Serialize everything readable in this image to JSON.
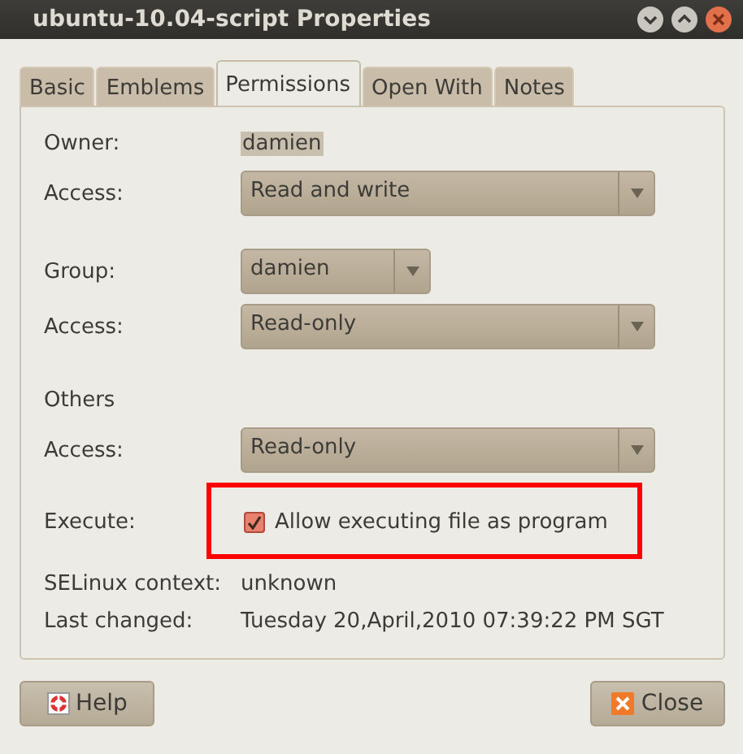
{
  "window": {
    "title": "ubuntu-10.04-script Properties"
  },
  "tabs": [
    {
      "label": "Basic",
      "selected": false
    },
    {
      "label": "Emblems",
      "selected": false
    },
    {
      "label": "Permissions",
      "selected": true
    },
    {
      "label": "Open With",
      "selected": false
    },
    {
      "label": "Notes",
      "selected": false
    }
  ],
  "sections": [
    {
      "rows": [
        {
          "kind": "value",
          "label": "Owner:",
          "value": "damien"
        },
        {
          "kind": "combo",
          "label": "Access:",
          "value": "Read and write",
          "wide": true
        }
      ]
    },
    {
      "rows": [
        {
          "kind": "combo",
          "label": "Group:",
          "value": "damien",
          "wide": false
        },
        {
          "kind": "combo",
          "label": "Access:",
          "value": "Read-only",
          "wide": true
        }
      ]
    },
    {
      "rows": [
        {
          "kind": "heading",
          "label": "Others"
        },
        {
          "kind": "combo",
          "label": "Access:",
          "value": "Read-only",
          "wide": true
        },
        {
          "kind": "checkbox",
          "label": "Execute:",
          "value": "Allow executing file as program",
          "checked": true
        },
        {
          "kind": "text",
          "label": "SELinux context:",
          "value": "unknown"
        },
        {
          "kind": "text",
          "label": "Last changed:",
          "value": "Tuesday 20,April,2010 07:39:22 PM SGT"
        }
      ]
    }
  ],
  "buttons": [
    {
      "kind": "help",
      "label": "Help"
    },
    {
      "kind": "close",
      "label": "Close"
    }
  ]
}
